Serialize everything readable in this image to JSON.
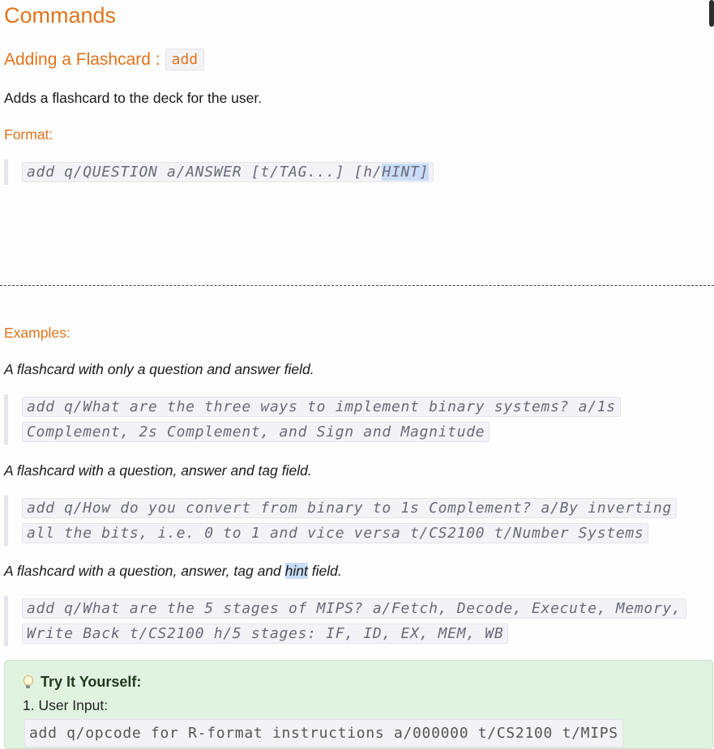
{
  "page": {
    "title": "Commands"
  },
  "section": {
    "heading": "Adding a Flashcard :",
    "command": "add",
    "description": "Adds a flashcard to the deck for the user.",
    "format_label": "Format:",
    "format_code_plain": "add q/QUESTION a/ANSWER [t/TAG...] [h/",
    "format_code_highlight": "HINT]",
    "examples_label": "Examples:"
  },
  "examples": [
    {
      "caption": "A flashcard with only a question and answer field.",
      "code": "add q/What are the three ways to implement binary systems? a/1s Complement, 2s Complement, and Sign and Magnitude"
    },
    {
      "caption": "A flashcard with a question, answer and tag field.",
      "code": "add q/How do you convert from binary to 1s Complement? a/By inverting all the bits, i.e. 0 to 1 and vice versa t/CS2100 t/Number Systems"
    },
    {
      "caption_before": "A flashcard with a question, answer, tag and ",
      "caption_highlight": "hint",
      "caption_after": " field.",
      "code": "add q/What are the 5 stages of MIPS? a/Fetch, Decode, Execute, Memory, Write Back t/CS2100 h/5 stages: IF, ID, EX, MEM, WB"
    }
  ],
  "tip": {
    "icon": "lightbulb-icon",
    "title": "Try It Yourself:",
    "step1": "1. User Input:",
    "step1_code": "add q/opcode for R-format instructions a/000000 t/CS2100 t/MIPS"
  },
  "colors": {
    "heading": "#e0741c",
    "tip_background": "#e0f2e0",
    "highlight": "#c9ddf7"
  }
}
